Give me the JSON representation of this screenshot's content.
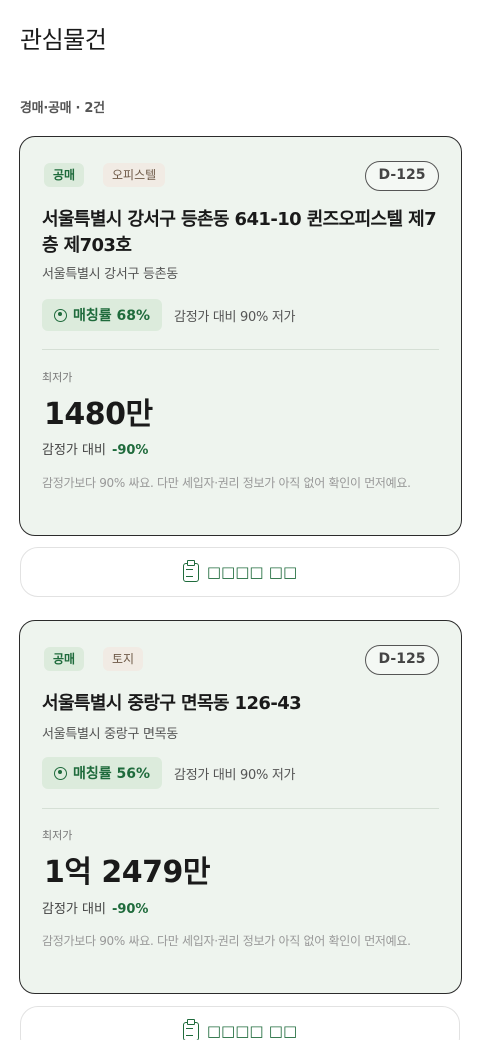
{
  "header": {
    "title": "관심물건"
  },
  "section": {
    "label": "경매·공매 · 2건"
  },
  "colors": {
    "accent": "#1f6b3c",
    "card_bg": "#eef4ee",
    "pill_bg": "#dcebdc"
  },
  "cards": [
    {
      "sale_type": "공매",
      "property_kind": "오피스텔",
      "dday": "D-125",
      "title": "서울특별시 강서구 등촌동 641-10 퀸즈오피스텔 제7층 제703호",
      "subtitle": "서울특별시 강서구 등촌동",
      "match_rate": "매칭률 68%",
      "match_note": "감정가 대비 90% 저가",
      "min_label": "최저가",
      "min_price": "1480만",
      "ratio_label": "감정가 대비",
      "ratio_value": "-90%",
      "memo": "감정가보다 90% 싸요. 다만 세입자·권리 정보가 아직 없어 확인이 먼저예요.",
      "action_label": "□□□□ □□",
      "action_icon": "clipboard-icon"
    },
    {
      "sale_type": "공매",
      "property_kind": "토지",
      "dday": "D-125",
      "title": "서울특별시 중랑구 면목동 126-43",
      "subtitle": "서울특별시 중랑구 면목동",
      "match_rate": "매칭률 56%",
      "match_note": "감정가 대비 90% 저가",
      "min_label": "최저가",
      "min_price": "1억 2479만",
      "ratio_label": "감정가 대비",
      "ratio_value": "-90%",
      "memo": "감정가보다 90% 싸요. 다만 세입자·권리 정보가 아직 없어 확인이 먼저예요.",
      "action_label": "□□□□ □□",
      "action_icon": "clipboard-icon"
    }
  ]
}
